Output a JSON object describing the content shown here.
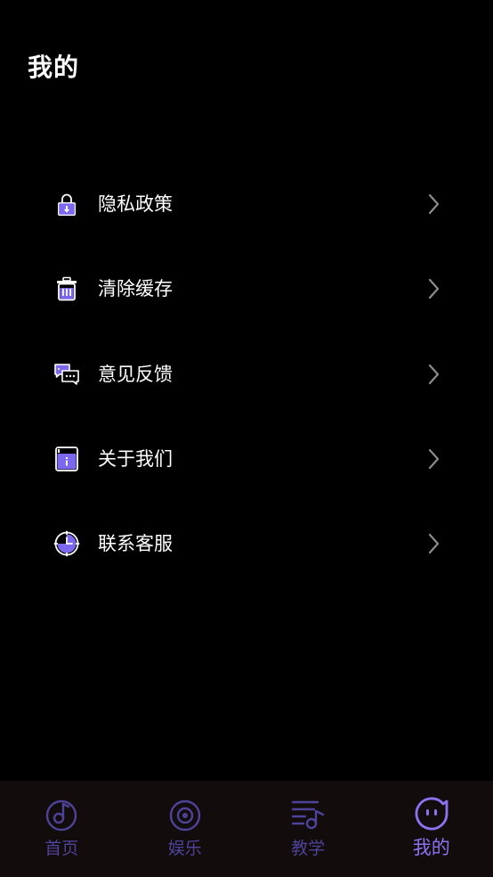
{
  "page": {
    "title": "我的"
  },
  "menu": {
    "items": [
      {
        "label": "隐私政策",
        "icon": "lock-icon"
      },
      {
        "label": "清除缓存",
        "icon": "trash-icon"
      },
      {
        "label": "意见反馈",
        "icon": "chat-bubbles-icon"
      },
      {
        "label": "关于我们",
        "icon": "info-card-icon"
      },
      {
        "label": "联系客服",
        "icon": "customer-service-clock-icon"
      }
    ],
    "chevron_icon": "chevron-right-icon"
  },
  "tabbar": {
    "tabs": [
      {
        "label": "首页",
        "icon": "music-note-icon",
        "active": false
      },
      {
        "label": "娱乐",
        "icon": "record-disc-icon",
        "active": false
      },
      {
        "label": "教学",
        "icon": "playlist-icon",
        "active": false
      },
      {
        "label": "我的",
        "icon": "face-icon",
        "active": true
      }
    ]
  },
  "colors": {
    "background": "#000000",
    "text": "#ffffff",
    "accent": "#8a73f0",
    "icon_fill": "#7b68ee",
    "tab_inactive": "#4e4398",
    "tabbar_background": "#130c0c",
    "chevron": "#8c8c8c"
  }
}
